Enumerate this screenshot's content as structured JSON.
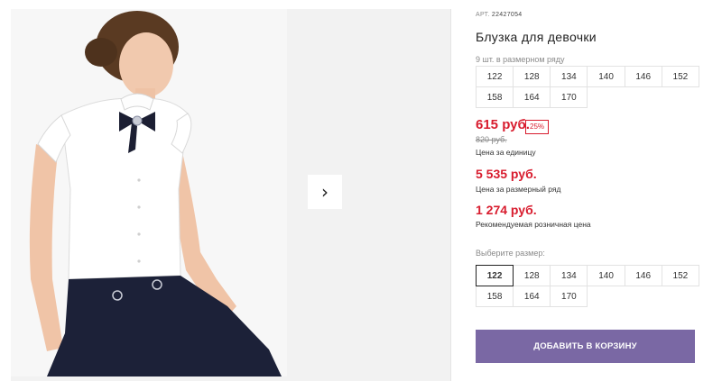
{
  "product": {
    "article_label": "АРТ.",
    "article_number": "22427054",
    "title": "Блузка для девочки",
    "pack_label": "9 шт. в размерном ряду",
    "pack_sizes": [
      "122",
      "128",
      "134",
      "140",
      "146",
      "152",
      "158",
      "164",
      "170"
    ],
    "price": "615 руб.",
    "discount": "25%",
    "old_price": "820 руб.",
    "unit_price_note": "Цена за единицу",
    "pack_price": "5 535 руб.",
    "pack_price_note": "Цена за размерный ряд",
    "retail_price": "1 274 руб.",
    "retail_price_note": "Рекомендуемая розничная цена",
    "choose_size_label": "Выберите размер:",
    "size_options": [
      "122",
      "128",
      "134",
      "140",
      "146",
      "152",
      "158",
      "164",
      "170"
    ],
    "selected_size": "122",
    "add_to_cart_label": "ДОБАВИТЬ В КОРЗИНУ"
  },
  "gallery": {
    "next_icon": "chevron-right-icon"
  },
  "colors": {
    "accent_price": "#d81c2e",
    "cart_button": "#7a68a4"
  }
}
